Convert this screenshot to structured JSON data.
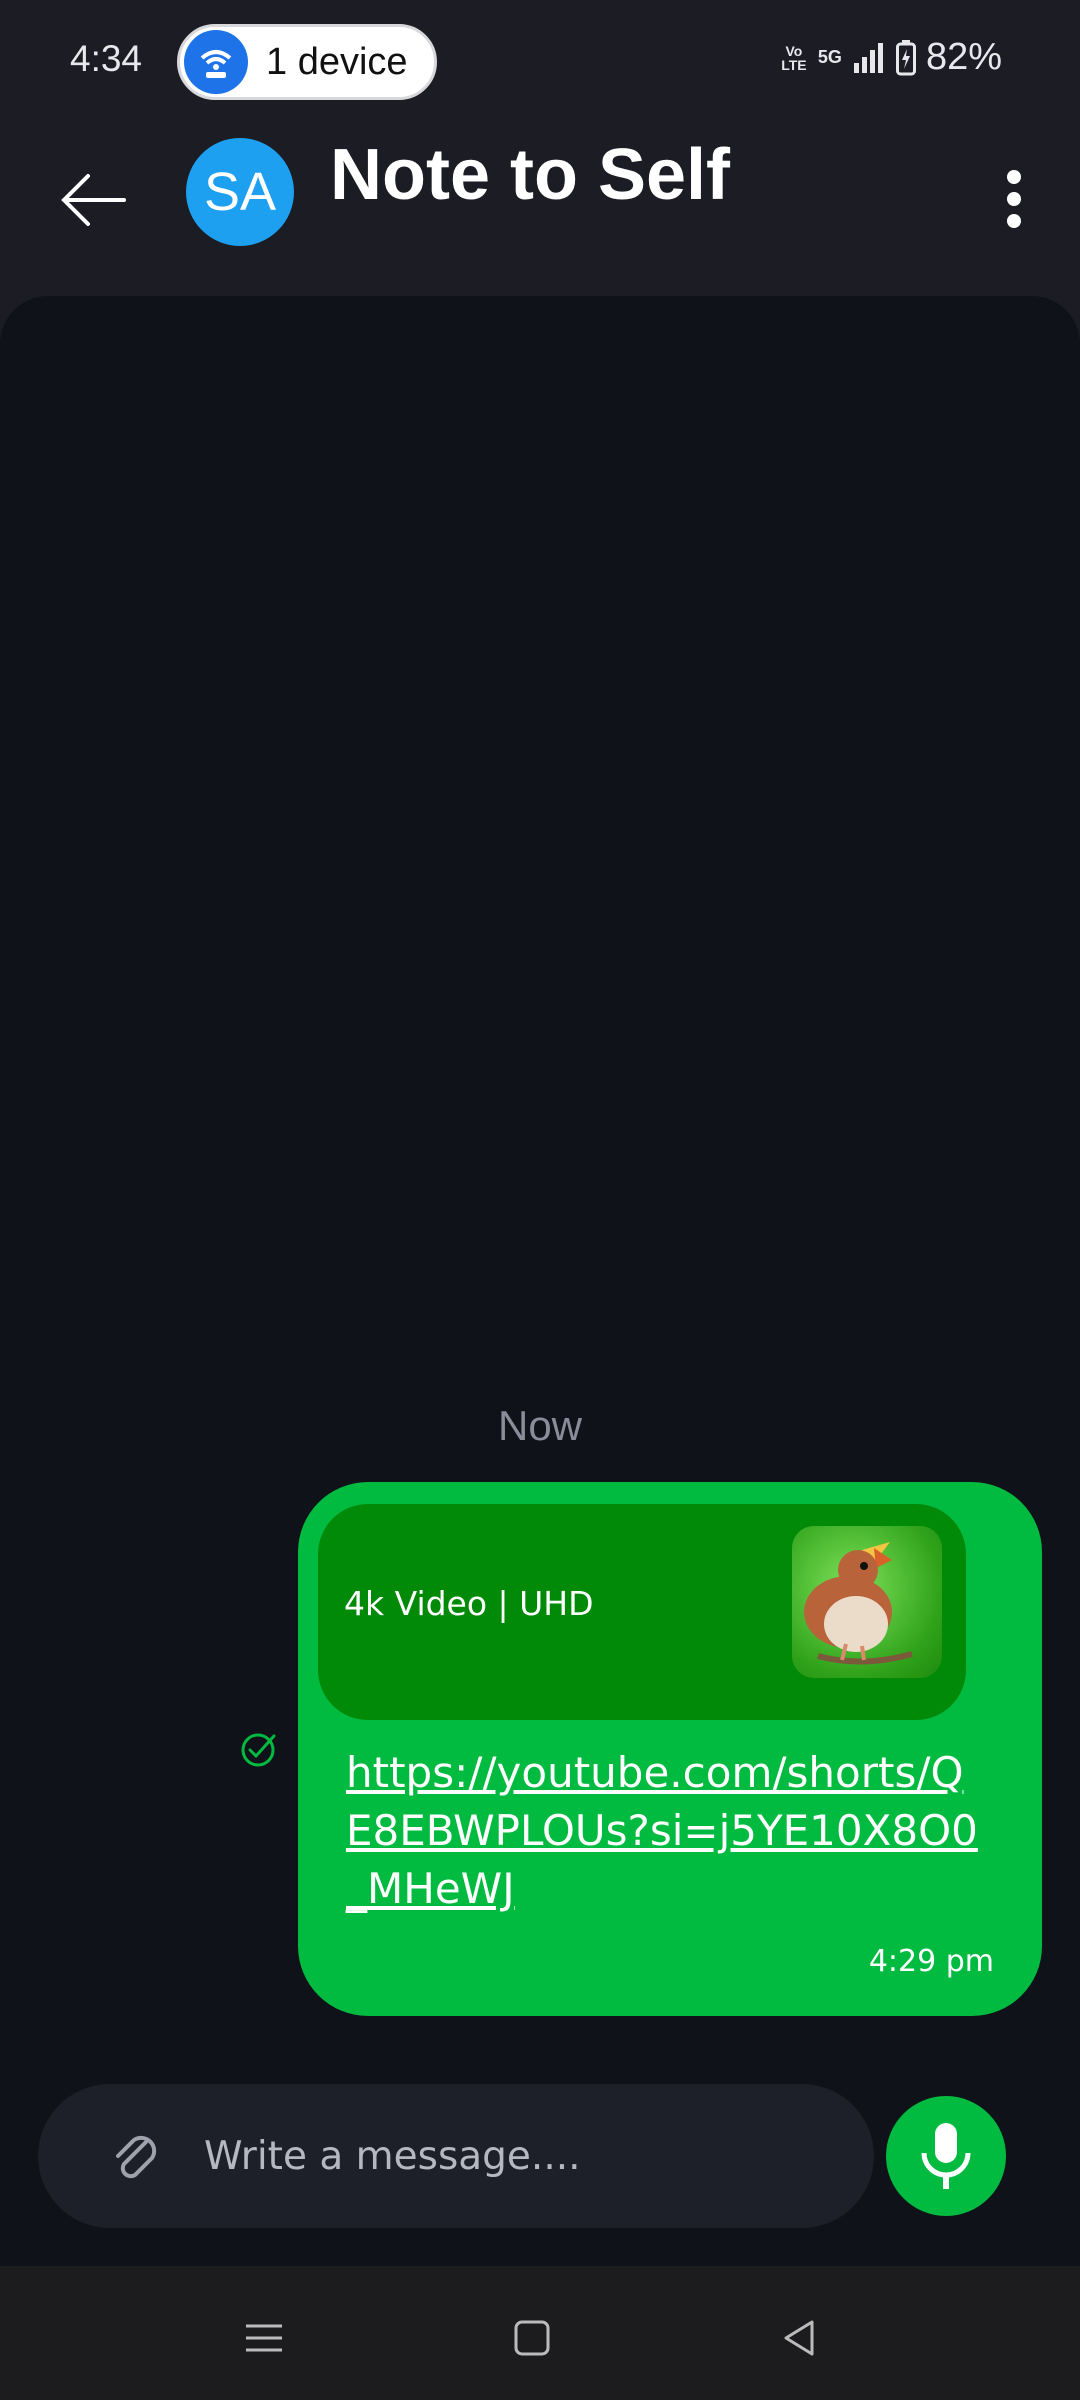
{
  "status_bar": {
    "time": "4:34",
    "hotspot_label": "1 device",
    "volte": "Vo LTE",
    "network": "5G",
    "battery": "82%"
  },
  "header": {
    "avatar_initials": "SA",
    "title": "Note to Self"
  },
  "chat": {
    "date_label": "Now",
    "messages": [
      {
        "preview_title": "4k Video | UHD",
        "link_text": "https://youtube.com/shorts/QE8EBWPLOUs?si=j5YE10X8O0_MHeWJ",
        "time": "4:29 pm",
        "status": "sent"
      }
    ]
  },
  "composer": {
    "placeholder": "Write a message...."
  },
  "colors": {
    "accent": "#00bb3f",
    "preview_bg": "#008a08",
    "avatar": "#1ea0f0",
    "background": "#10121a"
  },
  "icons": {
    "back": "arrow-left-icon",
    "menu": "more-vert-icon",
    "attach": "paperclip-icon",
    "mic": "microphone-icon",
    "sent": "check-circle-icon"
  }
}
